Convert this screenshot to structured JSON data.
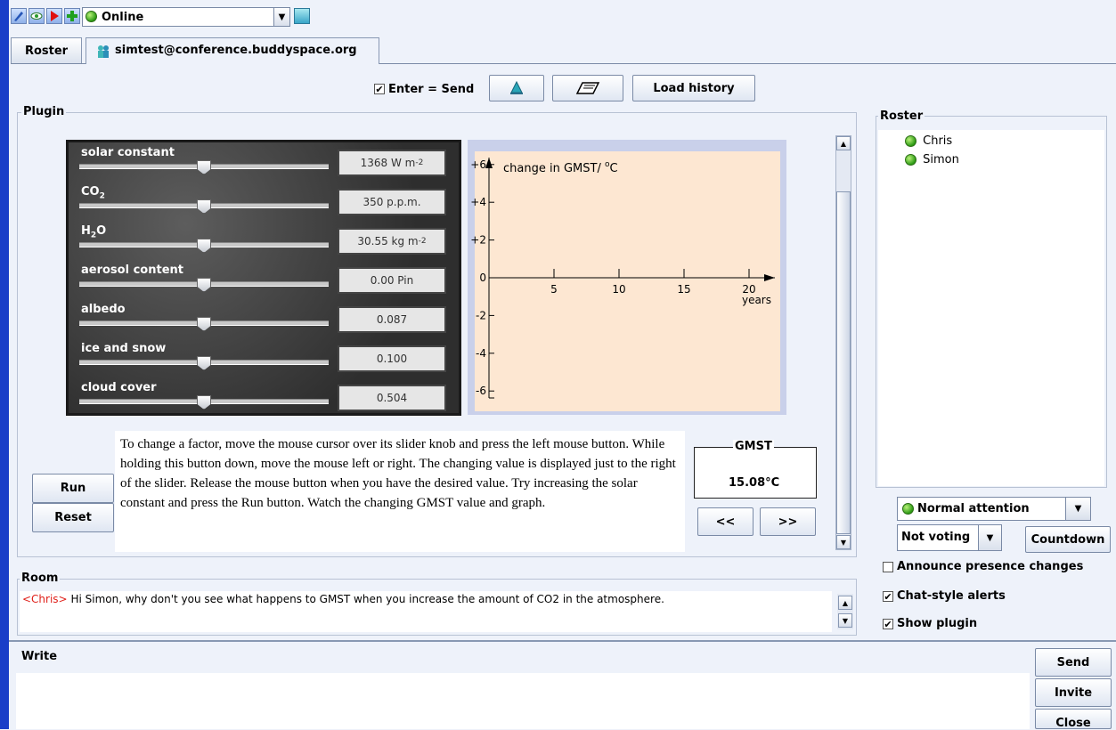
{
  "toolbar": {
    "status": "Online"
  },
  "tabs": [
    {
      "label": "Roster"
    },
    {
      "label": "simtest@conference.buddyspace.org"
    }
  ],
  "top_controls": {
    "enter_send_label": "Enter = Send",
    "load_history_label": "Load history"
  },
  "plugin": {
    "title": "Plugin",
    "sliders": [
      {
        "label": "solar constant",
        "value": "1368 W m",
        "sup": "-2",
        "level": 0.5
      },
      {
        "label": "CO",
        "sub": "2",
        "value": "350 p.p.m.",
        "sup": "",
        "level": 0.5
      },
      {
        "label": "H",
        "sub": "2",
        "label_suffix": "O",
        "value": "30.55 kg m",
        "sup": "-2",
        "level": 0.5
      },
      {
        "label": "aerosol content",
        "value": "0.00 Pin",
        "sup": "",
        "level": 0.5
      },
      {
        "label": "albedo",
        "value": "0.087",
        "sup": "",
        "level": 0.5
      },
      {
        "label": "ice and snow",
        "value": "0.100",
        "sup": "",
        "level": 0.5
      },
      {
        "label": "cloud cover",
        "value": "0.504",
        "sup": "",
        "level": 0.5
      }
    ],
    "graph": {
      "ylabel_prefix": "change in GMST/ ",
      "ylabel_deg": "o",
      "ylabel_unit": "C",
      "y_ticks": [
        "+6",
        "+4",
        "+2",
        "0",
        "-2",
        "-4",
        "-6"
      ],
      "x_ticks": [
        "5",
        "10",
        "15",
        "20"
      ],
      "x_unit": "years"
    },
    "instructions": "To change a factor, move the mouse cursor over its slider knob and press the left mouse button. While holding this button down, move the mouse left or right. The changing value is displayed just to the right of the slider. Release the mouse button when you have the desired value. Try increasing the solar constant and press the Run button. Watch the changing GMST value and graph.",
    "run_label": "Run",
    "reset_label": "Reset",
    "gmst_title": "GMST",
    "gmst_value": "15.08°C",
    "prev_label": "<<",
    "next_label": ">>"
  },
  "roster": {
    "title": "Roster",
    "members": [
      "Chris",
      "Simon"
    ],
    "attention": "Normal attention",
    "voting": "Not voting",
    "countdown_label": "Countdown",
    "options": [
      {
        "label": "Announce presence changes",
        "checked": false
      },
      {
        "label": "Chat-style alerts",
        "checked": true
      },
      {
        "label": "Show plugin",
        "checked": true
      }
    ]
  },
  "room": {
    "title": "Room",
    "sender": "<Chris>",
    "message": " Hi Simon, why don't you see what happens to GMST when you increase the amount of CO2 in the atmosphere."
  },
  "write": {
    "title": "Write",
    "send_label": "Send",
    "invite_label": "Invite",
    "close_label": "Close"
  },
  "colors": {
    "sender": "#e0201a",
    "graph_bg": "#fde7d2",
    "graph_frame": "#c9d0ea",
    "accent_bar": "#1a3ec8"
  }
}
